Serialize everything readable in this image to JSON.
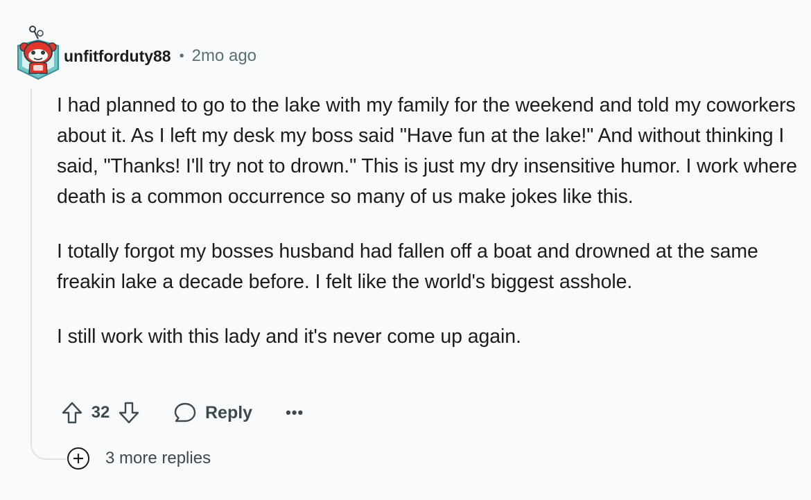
{
  "comment": {
    "author": "unfitforduty88",
    "separator": "•",
    "time_ago": "2mo ago",
    "avatar": "snoo-avatar-icon",
    "paragraphs": [
      "I had planned to go to the lake with my family for the weekend and told my coworkers about it. As I left my desk my boss said \"Have fun at the lake!\" And without thinking I said, \"Thanks! I'll try not to drown.\" This is just my dry insensitive humor. I work where death is a common occurrence so many of us make jokes like this.",
      "I totally forgot my bosses husband had fallen off a boat and drowned at the same freakin lake a decade before. I felt like the world's biggest asshole.",
      "I still work with this lady and it's never come up again."
    ]
  },
  "actions": {
    "upvote_icon": "upvote-arrow-icon",
    "score": "32",
    "downvote_icon": "downvote-arrow-icon",
    "reply_icon": "speech-bubble-icon",
    "reply_label": "Reply",
    "more_label": "•••"
  },
  "more_replies": {
    "icon": "plus-circle-icon",
    "label": "3 more replies"
  },
  "colors": {
    "background": "#f9fafb",
    "text": "#1c1c1c",
    "muted": "#576f76",
    "action_text": "#3c4a50",
    "thread_line": "#dfe3e7"
  }
}
